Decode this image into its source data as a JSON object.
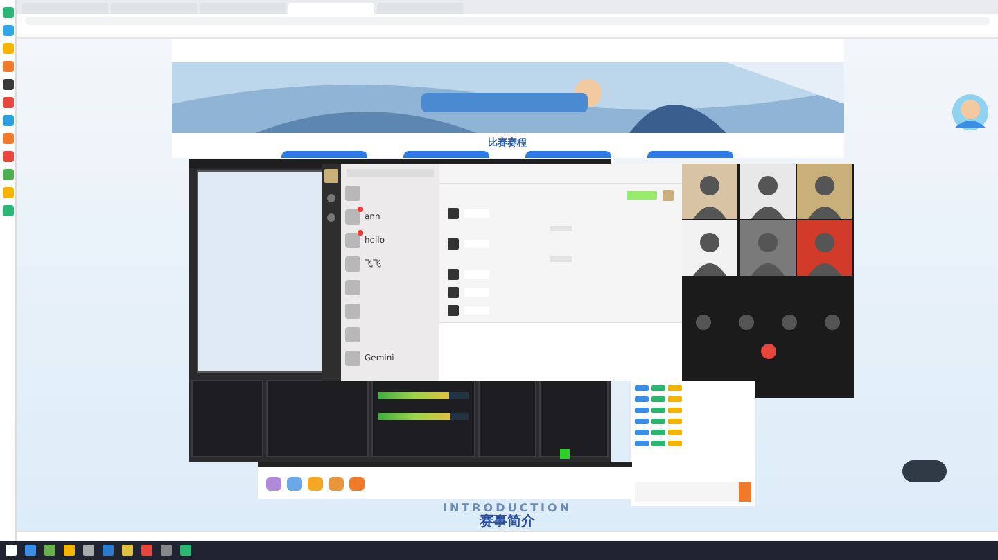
{
  "browser": {
    "tabs": [
      {
        "selected": false
      },
      {
        "selected": false
      },
      {
        "selected": false
      },
      {
        "selected": true
      },
      {
        "selected": false
      }
    ]
  },
  "page": {
    "schedule_title": "比赛赛程",
    "intro_title": "赛事简介",
    "intro_background_text": "INTRODUCTION"
  },
  "wechat": {
    "contacts": [
      {
        "badge": false,
        "selected": false
      },
      {
        "name": "ann",
        "badge": true,
        "selected": false
      },
      {
        "name": "hello",
        "badge": true,
        "selected": false
      },
      {
        "name": "飞飞",
        "badge": false,
        "selected": false
      },
      {
        "badge": false,
        "selected": false
      },
      {
        "badge": false,
        "selected": false
      },
      {
        "badge": false,
        "selected": false
      },
      {
        "name": "Gemini",
        "badge": false,
        "selected": false
      }
    ],
    "messages": [
      {
        "kind": "outgoing"
      },
      {
        "kind": "incoming"
      },
      {
        "kind": "time"
      },
      {
        "kind": "incoming"
      },
      {
        "kind": "time"
      },
      {
        "kind": "incoming"
      },
      {
        "kind": "incoming"
      },
      {
        "kind": "incoming"
      }
    ]
  },
  "video_call": {
    "tiles": [
      {
        "color": "#d9c3a5"
      },
      {
        "color": "#e8e8e8"
      },
      {
        "color": "#c9b07a"
      },
      {
        "color": "#f2f2f2"
      },
      {
        "color": "#7a7a7a"
      },
      {
        "color": "#d23a2a"
      }
    ],
    "controls": [
      {
        "kind": "mic"
      },
      {
        "kind": "speaker"
      },
      {
        "kind": "camera"
      },
      {
        "kind": "switch"
      },
      {
        "kind": "hangup"
      }
    ]
  },
  "obs": {
    "meters": [
      {
        "level": 0.78
      },
      {
        "level": 0.8
      }
    ],
    "recording": true
  }
}
